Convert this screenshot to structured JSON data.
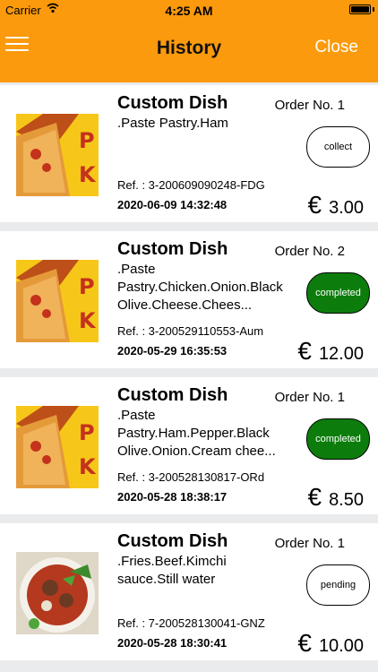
{
  "status_bar": {
    "carrier": "Carrier",
    "time": "4:25 AM"
  },
  "header": {
    "title": "History",
    "close_label": "Close"
  },
  "colors": {
    "header": "#fb9a0c",
    "completed": "#0c7d0c"
  },
  "orders": [
    {
      "name": "Custom Dish",
      "order_no": "Order No. 1",
      "ingredients": ".Paste Pastry.Ham",
      "status": "collect",
      "ref": "Ref. : 3-200609090248-FDG",
      "date": "2020-06-09 14:32:48",
      "currency": "€",
      "price": "3.00",
      "image": "pizza-logo"
    },
    {
      "name": "Custom Dish",
      "order_no": "Order No. 2",
      "ingredients": ".Paste Pastry.Chicken.Onion.Black Olive.Cheese.Chees...",
      "status": "completed",
      "ref": "Ref. : 3-200529110553-Aum",
      "date": "2020-05-29 16:35:53",
      "currency": "€",
      "price": "12.00",
      "image": "pizza-logo"
    },
    {
      "name": "Custom Dish",
      "order_no": "Order No. 1",
      "ingredients": ".Paste Pastry.Ham.Pepper.Black Olive.Onion.Cream chee...",
      "status": "completed",
      "ref": "Ref. : 3-200528130817-ORd",
      "date": "2020-05-28 18:38:17",
      "currency": "€",
      "price": "8.50",
      "image": "pizza-logo"
    },
    {
      "name": "Custom Dish",
      "order_no": "Order No. 1",
      "ingredients": ".Fries.Beef.Kimchi sauce.Still water",
      "status": "pending",
      "ref": "Ref. : 7-200528130041-GNZ",
      "date": "2020-05-28 18:30:41",
      "currency": "€",
      "price": "10.00",
      "image": "soup-bowl"
    }
  ]
}
